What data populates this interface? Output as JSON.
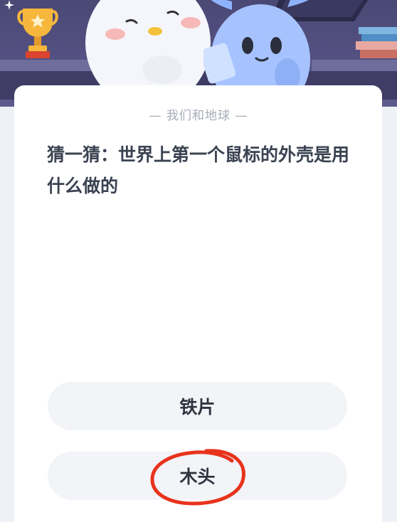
{
  "quiz": {
    "category": "— 我们和地球 —",
    "question": "猜一猜：世界上第一个鼠标的外壳是用什么做的",
    "options": [
      {
        "label": "铁片"
      },
      {
        "label": "木头"
      }
    ]
  },
  "annotation": {
    "circled_option_index": 1,
    "circle_color": "#e8331c"
  },
  "colors": {
    "header_bg": "#575487",
    "card_bg": "#ffffff",
    "option_bg": "#f2f4f8",
    "question_text": "#3b4352",
    "subtitle_text": "#a6acb8"
  },
  "icons": [
    "trophy-icon",
    "sparkle-icon",
    "books-icon"
  ]
}
